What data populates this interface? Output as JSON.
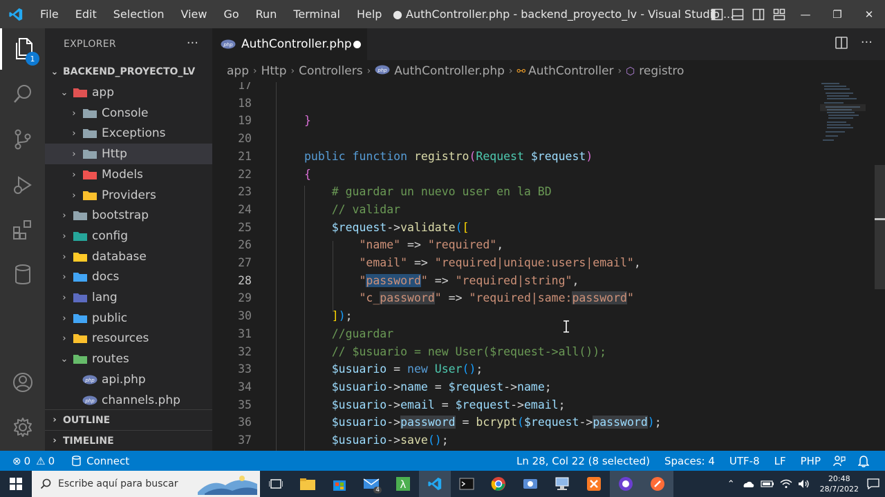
{
  "window": {
    "title": "● AuthController.php - backend_proyecto_lv - Visual Studio ..."
  },
  "menu": [
    "File",
    "Edit",
    "Selection",
    "View",
    "Go",
    "Run",
    "Terminal",
    "Help"
  ],
  "activity": {
    "explorer_badge": "1"
  },
  "sidebar": {
    "header": "EXPLORER",
    "more": "···",
    "root": "BACKEND_PROYECTO_LV",
    "tree": [
      {
        "label": "app",
        "depth": 1,
        "expanded": true,
        "icon": "folder-app",
        "color": "#e05252"
      },
      {
        "label": "Console",
        "depth": 2,
        "expanded": false,
        "icon": "folder",
        "color": "#90a4ae"
      },
      {
        "label": "Exceptions",
        "depth": 2,
        "expanded": false,
        "icon": "folder",
        "color": "#90a4ae"
      },
      {
        "label": "Http",
        "depth": 2,
        "expanded": false,
        "icon": "folder",
        "color": "#90a4ae",
        "selected": true
      },
      {
        "label": "Models",
        "depth": 2,
        "expanded": false,
        "icon": "folder-models",
        "color": "#ef5350"
      },
      {
        "label": "Providers",
        "depth": 2,
        "expanded": false,
        "icon": "folder-providers",
        "color": "#fbc02d"
      },
      {
        "label": "bootstrap",
        "depth": 1,
        "expanded": false,
        "icon": "folder",
        "color": "#90a4ae"
      },
      {
        "label": "config",
        "depth": 1,
        "expanded": false,
        "icon": "folder-config",
        "color": "#26a69a"
      },
      {
        "label": "database",
        "depth": 1,
        "expanded": false,
        "icon": "folder-database",
        "color": "#ffca28"
      },
      {
        "label": "docs",
        "depth": 1,
        "expanded": false,
        "icon": "folder-docs",
        "color": "#42a5f5"
      },
      {
        "label": "lang",
        "depth": 1,
        "expanded": false,
        "icon": "folder-lang",
        "color": "#5c6bc0"
      },
      {
        "label": "public",
        "depth": 1,
        "expanded": false,
        "icon": "folder-public",
        "color": "#42a5f5"
      },
      {
        "label": "resources",
        "depth": 1,
        "expanded": false,
        "icon": "folder-resources",
        "color": "#fbc02d"
      },
      {
        "label": "routes",
        "depth": 1,
        "expanded": true,
        "icon": "folder-routes",
        "color": "#66bb6a"
      },
      {
        "label": "api.php",
        "depth": 2,
        "file": true,
        "icon": "php-icon"
      },
      {
        "label": "channels.php",
        "depth": 2,
        "file": true,
        "icon": "php-icon"
      }
    ],
    "outline": "OUTLINE",
    "timeline": "TIMELINE"
  },
  "editor": {
    "tab_label": "AuthController.php",
    "breadcrumb": [
      "app",
      "Http",
      "Controllers",
      "AuthController.php",
      "AuthController",
      "registro"
    ]
  },
  "code_lines": [
    {
      "n": "17",
      "html": ""
    },
    {
      "n": "18",
      "html": ""
    },
    {
      "n": "19",
      "html": "<span class='br2'>}</span>"
    },
    {
      "n": "20",
      "html": ""
    },
    {
      "n": "21",
      "html": "<span class='kw'>public</span> <span class='kw'>function</span> <span class='fn'>registro</span><span class='br2'>(</span><span class='ty'>Request</span> <span class='var'>$request</span><span class='br2'>)</span>"
    },
    {
      "n": "22",
      "html": "<span class='br2'>{</span>"
    },
    {
      "n": "23",
      "html": "    <span class='com'># guardar un nuevo user en la BD</span>"
    },
    {
      "n": "24",
      "html": "    <span class='com'>// validar</span>"
    },
    {
      "n": "25",
      "html": "    <span class='var'>$request</span><span class='pl'>-&gt;</span><span class='fn'>validate</span><span class='br3'>(</span><span class='br1'>[</span>"
    },
    {
      "n": "26",
      "html": "        <span class='str'>\"name\"</span> <span class='pl'>=&gt;</span> <span class='str'>\"required\"</span><span class='pl'>,</span>"
    },
    {
      "n": "27",
      "html": "        <span class='str'>\"email\"</span> <span class='pl'>=&gt;</span> <span class='str'>\"required|unique:users|email\"</span><span class='pl'>,</span>"
    },
    {
      "n": "28",
      "html": "        <span class='str'>\"<span class='sel'>password</span>\"</span> <span class='pl'>=&gt;</span> <span class='str'>\"required|string\"</span><span class='pl'>,</span>"
    },
    {
      "n": "29",
      "html": "        <span class='str'>\"c_<span class='hl'>password</span>\"</span> <span class='pl'>=&gt;</span> <span class='str'>\"required|same:<span class='hl'>password</span>\"</span>"
    },
    {
      "n": "30",
      "html": "    <span class='br1'>]</span><span class='br3'>)</span><span class='pl'>;</span>"
    },
    {
      "n": "31",
      "html": "    <span class='com'>//guardar</span>"
    },
    {
      "n": "32",
      "html": "    <span class='com'>// $usuario = new User($request-&gt;all());</span>"
    },
    {
      "n": "33",
      "html": "    <span class='var'>$usuario</span> <span class='pl'>=</span> <span class='kw'>new</span> <span class='ty'>User</span><span class='br3'>()</span><span class='pl'>;</span>"
    },
    {
      "n": "34",
      "html": "    <span class='var'>$usuario</span><span class='pl'>-&gt;</span><span class='var'>name</span> <span class='pl'>=</span> <span class='var'>$request</span><span class='pl'>-&gt;</span><span class='var'>name</span><span class='pl'>;</span>"
    },
    {
      "n": "35",
      "html": "    <span class='var'>$usuario</span><span class='pl'>-&gt;</span><span class='var'>email</span> <span class='pl'>=</span> <span class='var'>$request</span><span class='pl'>-&gt;</span><span class='var'>email</span><span class='pl'>;</span>"
    },
    {
      "n": "36",
      "html": "    <span class='var'>$usuario</span><span class='pl'>-&gt;</span><span class='var hl'>password</span> <span class='pl'>=</span> <span class='fn'>bcrypt</span><span class='br3'>(</span><span class='var'>$request</span><span class='pl'>-&gt;</span><span class='var hl'>password</span><span class='br3'>)</span><span class='pl'>;</span>"
    },
    {
      "n": "37",
      "html": "    <span class='var'>$usuario</span><span class='pl'>-&gt;</span><span class='fn'>save</span><span class='br3'>()</span><span class='pl'>;</span>"
    }
  ],
  "current_line": "28",
  "statusbar": {
    "errors": "0",
    "warnings": "0",
    "connect": "Connect",
    "position": "Ln 28, Col 22 (8 selected)",
    "spaces": "Spaces: 4",
    "encoding": "UTF-8",
    "eol": "LF",
    "language": "PHP"
  },
  "taskbar": {
    "search_placeholder": "Escribe aquí para buscar",
    "mail_badge": "4",
    "time": "20:48",
    "date": "28/7/2022"
  },
  "colors": {
    "accent": "#007acc",
    "titlebar": "#3c3c3c",
    "sidebar": "#252526",
    "editor": "#1e1e1e"
  }
}
